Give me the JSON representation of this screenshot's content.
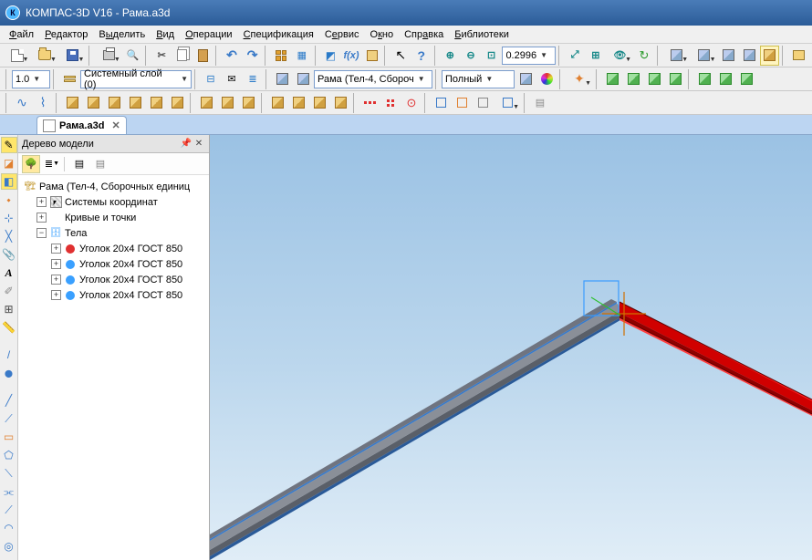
{
  "title": "КОМПАС-3D V16  - Рама.a3d",
  "menu": [
    "Файл",
    "Редактор",
    "Выделить",
    "Вид",
    "Операции",
    "Спецификация",
    "Сервис",
    "Окно",
    "Справка",
    "Библиотеки"
  ],
  "menu_u": [
    "Ф",
    "Р",
    "ы",
    "В",
    "О",
    "С",
    "е",
    "к",
    "а",
    "Б"
  ],
  "tb2": {
    "thickness": "1.0",
    "layer": "Системный слой (0)",
    "part": "Рама (Тел-4, Сбороч",
    "style": "Полный"
  },
  "zoom": "0.2996",
  "tab": "Рама.a3d",
  "panel_title": "Дерево модели",
  "tree": {
    "root": "Рама (Тел-4, Сборочных единиц",
    "n1": "Системы координат",
    "n2": "Кривые и точки",
    "n3": "Тела",
    "p1": "Уголок  20x4 ГОСТ 850",
    "p2": "Уголок  20x4 ГОСТ 850",
    "p3": "Уголок  20x4 ГОСТ 850",
    "p4": "Уголок  20x4 ГОСТ 850"
  }
}
